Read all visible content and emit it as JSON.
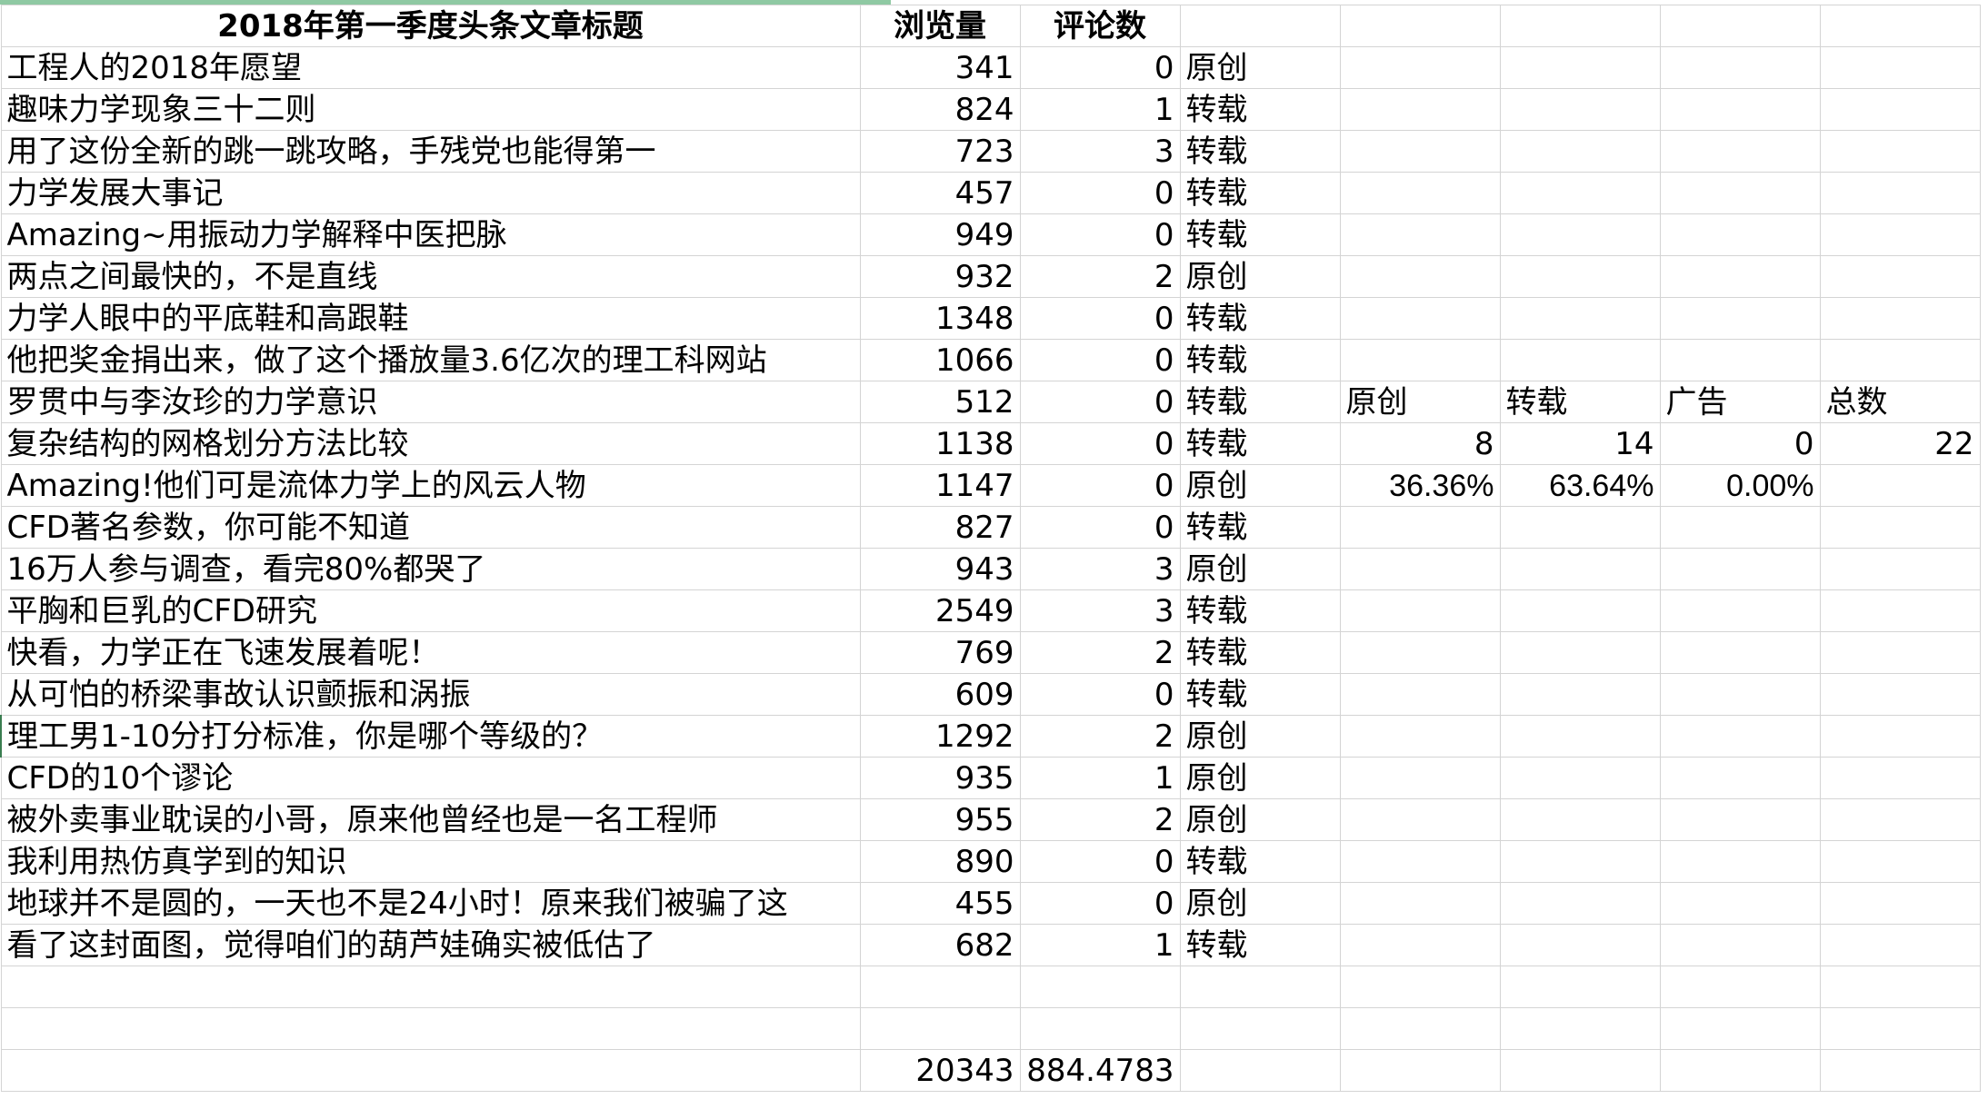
{
  "header": {
    "title": "2018年第一季度头条文章标题",
    "views": "浏览量",
    "comments": "评论数"
  },
  "rows": [
    {
      "title": "工程人的2018年愿望",
      "views": "341",
      "comments": "0",
      "type": "原创"
    },
    {
      "title": "趣味力学现象三十二则",
      "views": "824",
      "comments": "1",
      "type": "转载"
    },
    {
      "title": "用了这份全新的跳一跳攻略，手残党也能得第一",
      "views": "723",
      "comments": "3",
      "type": "转载"
    },
    {
      "title": "力学发展大事记",
      "views": "457",
      "comments": "0",
      "type": "转载"
    },
    {
      "title": "Amazing~用振动力学解释中医把脉",
      "views": "949",
      "comments": "0",
      "type": "转载"
    },
    {
      "title": "两点之间最快的，不是直线",
      "views": "932",
      "comments": "2",
      "type": "原创"
    },
    {
      "title": "力学人眼中的平底鞋和高跟鞋",
      "views": "1348",
      "comments": "0",
      "type": "转载"
    },
    {
      "title": "他把奖金捐出来，做了这个播放量3.6亿次的理工科网站",
      "views": "1066",
      "comments": "0",
      "type": "转载"
    },
    {
      "title": "罗贯中与李汝珍的力学意识",
      "views": "512",
      "comments": "0",
      "type": "转载"
    },
    {
      "title": "复杂结构的网格划分方法比较",
      "views": "1138",
      "comments": "0",
      "type": "转载"
    },
    {
      "title": "Amazing!他们可是流体力学上的风云人物",
      "views": "1147",
      "comments": "0",
      "type": "原创"
    },
    {
      "title": "CFD著名参数，你可能不知道",
      "views": "827",
      "comments": "0",
      "type": "转载"
    },
    {
      "title": "16万人参与调查，看完80%都哭了",
      "views": "943",
      "comments": "3",
      "type": "原创"
    },
    {
      "title": "平胸和巨乳的CFD研究",
      "views": "2549",
      "comments": "3",
      "type": "转载"
    },
    {
      "title": "快看，力学正在飞速发展着呢！",
      "views": "769",
      "comments": "2",
      "type": "转载"
    },
    {
      "title": "从可怕的桥梁事故认识颤振和涡振",
      "views": "609",
      "comments": "0",
      "type": "转载"
    },
    {
      "title": "理工男1-10分打分标准，你是哪个等级的？",
      "views": "1292",
      "comments": "2",
      "type": "原创"
    },
    {
      "title": "CFD的10个谬论",
      "views": "935",
      "comments": "1",
      "type": "原创"
    },
    {
      "title": "被外卖事业耽误的小哥，原来他曾经也是一名工程师",
      "views": "955",
      "comments": "2",
      "type": "原创"
    },
    {
      "title": "我利用热仿真学到的知识",
      "views": "890",
      "comments": "0",
      "type": "转载"
    },
    {
      "title": "地球并不是圆的，一天也不是24小时！原来我们被骗了这",
      "views": "455",
      "comments": "0",
      "type": "原创"
    },
    {
      "title": "看了这封面图，觉得咱们的葫芦娃确实被低估了",
      "views": "682",
      "comments": "1",
      "type": "转载"
    }
  ],
  "summary": {
    "labels": [
      "原创",
      "转载",
      "广告",
      "总数"
    ],
    "counts": [
      "8",
      "14",
      "0",
      "22"
    ],
    "percents": [
      "36.36%",
      "63.64%",
      "0.00%",
      ""
    ]
  },
  "totals": {
    "views": "20343",
    "comments": "884.4783"
  }
}
